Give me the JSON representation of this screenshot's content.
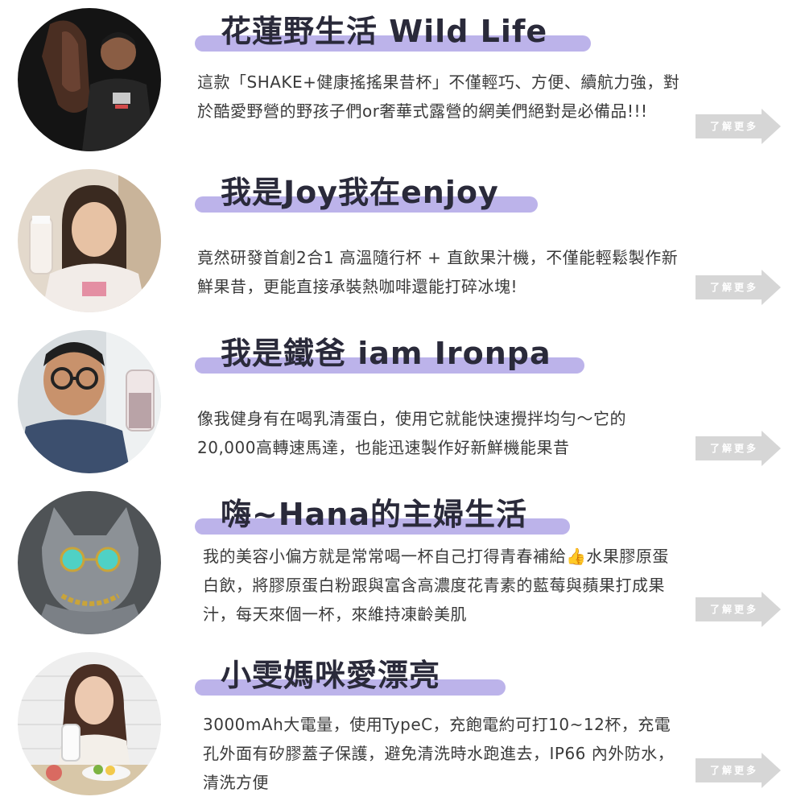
{
  "colors": {
    "title_highlight": "#bcb3ea",
    "more_button_bg": "#d6d6d6",
    "title_text": "#2a2a3a",
    "body_text": "#3a3a3a"
  },
  "cards": [
    {
      "title": "花蓮野生活 Wild Life",
      "description": "這款「SHAKE+健康搖搖果昔杯」不僅輕巧、方便、續航力強，對於酷愛野營的野孩子們or奢華式露營的網美們絕對是必備品!!!",
      "more_label": "了解更多",
      "avatar_icon": "man-with-horse-photo"
    },
    {
      "title": "我是Joy我在enjoy",
      "description": "竟然研發首創2合1 高溫隨行杯 + 直飲果汁機，不僅能輕鬆製作新鮮果昔，更能直接承裝熱咖啡還能打碎冰塊!",
      "more_label": "了解更多",
      "avatar_icon": "woman-holding-bottle-photo"
    },
    {
      "title": "我是鐵爸 iam Ironpa",
      "description": "像我健身有在喝乳清蛋白，使用它就能快速攪拌均勻～它的20,000高轉速馬達，也能迅速製作好新鮮機能果昔",
      "more_label": "了解更多",
      "avatar_icon": "man-with-glasses-photo"
    },
    {
      "title": "嗨~Hana的主婦生活",
      "description": "我的美容小偏方就是常常喝一杯自己打得青春補給👍水果膠原蛋白飲，將膠原蛋白粉跟與富含高濃度花青素的藍莓與蘋果打成果汁，每天來個一杯，來維持凍齡美肌",
      "more_label": "了解更多",
      "avatar_icon": "cat-with-sunglasses-photo"
    },
    {
      "title": "小雯媽咪愛漂亮",
      "description": "3000mAh大電量，使用TypeC，充飽電約可打10~12杯，充電孔外面有矽膠蓋子保護，避免清洗時水跑進去，IP66 內外防水，清洗方便",
      "more_label": "了解更多",
      "avatar_icon": "woman-at-table-photo"
    }
  ]
}
